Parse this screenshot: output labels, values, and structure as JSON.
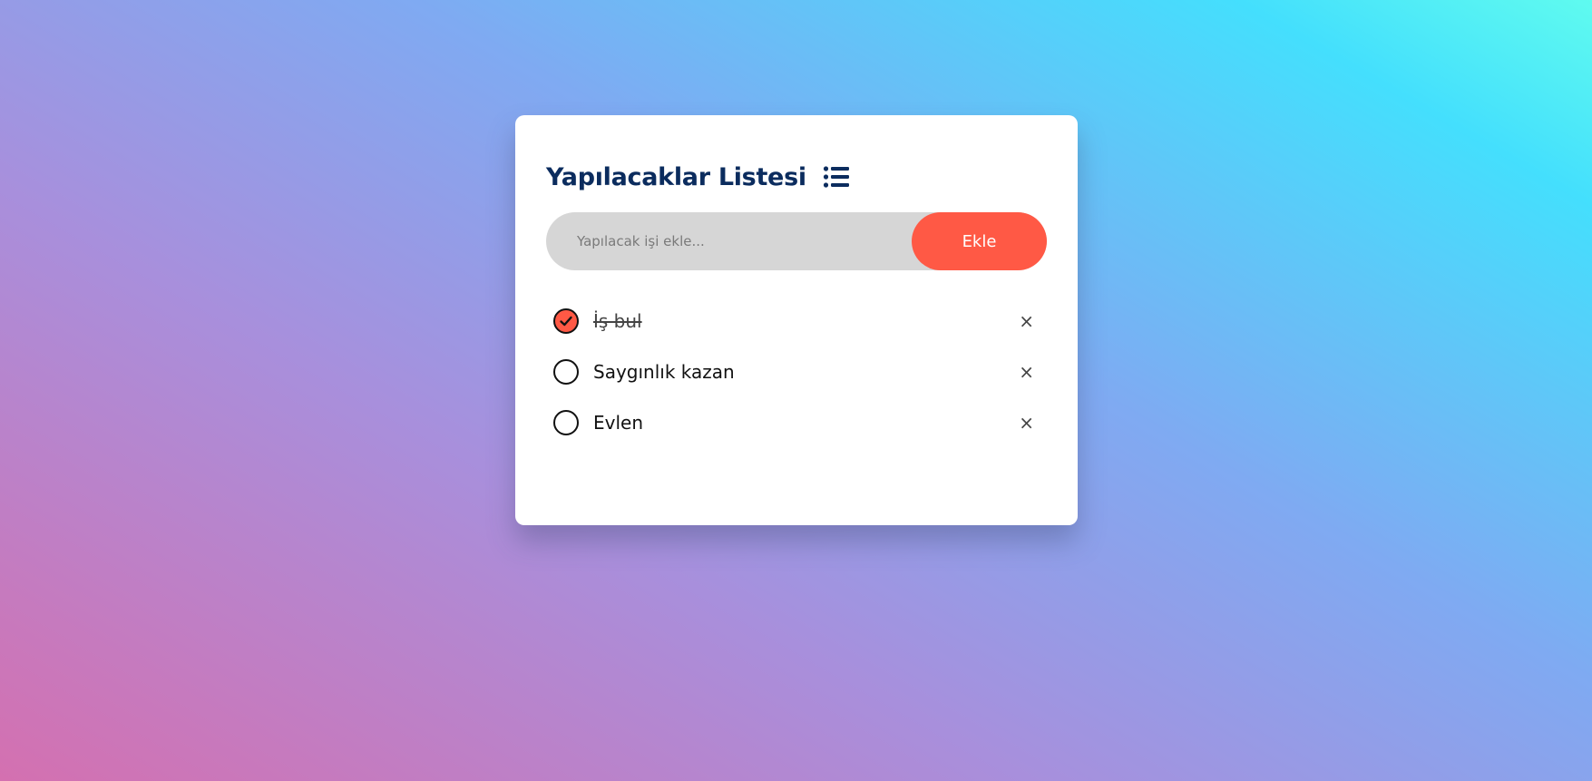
{
  "app": {
    "title": "Yapılacaklar Listesi",
    "title_icon": "list-icon"
  },
  "form": {
    "placeholder": "Yapılacak işi ekle...",
    "value": "",
    "add_label": "Ekle"
  },
  "tasks": [
    {
      "text": "İş bul",
      "done": true
    },
    {
      "text": "Saygınlık kazan",
      "done": false
    },
    {
      "text": "Evlen",
      "done": false
    }
  ],
  "remove_symbol": "×",
  "colors": {
    "accent": "#ff5945",
    "title": "#0b2c5e",
    "input_bg": "#d6d6d6",
    "card_bg": "#ffffff"
  }
}
